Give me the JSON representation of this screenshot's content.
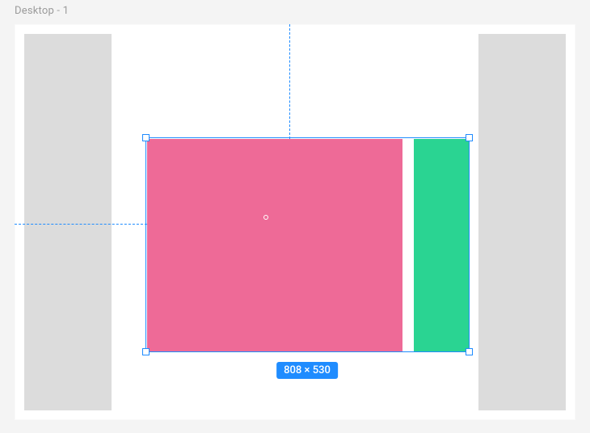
{
  "frame": {
    "label": "Desktop - 1"
  },
  "selection": {
    "size_badge": "808 × 530",
    "accent_color": "#1f8cff"
  },
  "blocks": {
    "pink_color": "#ee6a97",
    "green_color": "#2ad492"
  }
}
